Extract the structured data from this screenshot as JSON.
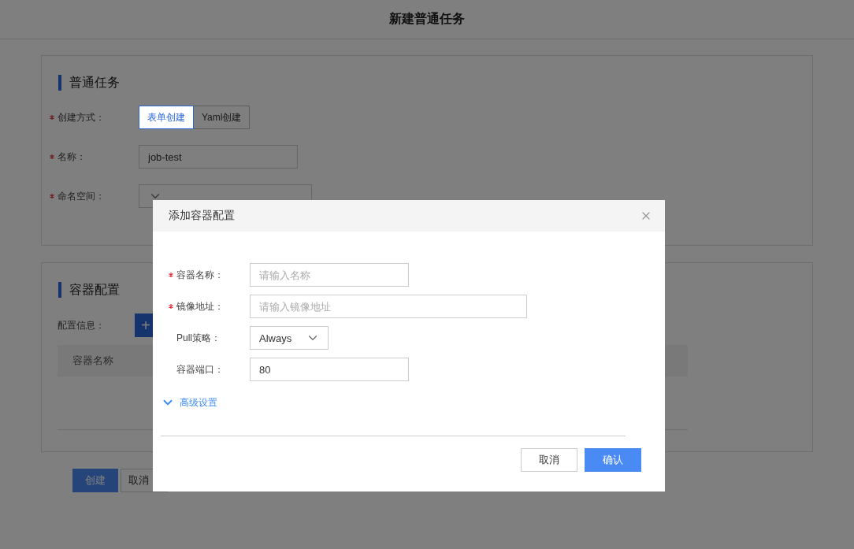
{
  "header": {
    "title": "新建普通任务"
  },
  "basic_section": {
    "title": "普通任务",
    "fields": [
      {
        "kind": "segmented",
        "label": "创建方式：",
        "required": true,
        "options": [
          {
            "label": "表单创建",
            "selected": true
          },
          {
            "label": "Yaml创建",
            "selected": false
          }
        ]
      },
      {
        "kind": "input",
        "label": "名称：",
        "required": true,
        "value": "job-test"
      },
      {
        "kind": "select",
        "label": "命名空间：",
        "required": true
      }
    ]
  },
  "container_section": {
    "title": "容器配置",
    "config_label": "配置信息：",
    "add_button": "+",
    "table": {
      "columns": [
        "容器名称"
      ]
    }
  },
  "actions": [
    {
      "label": "创建",
      "primary": true
    },
    {
      "label": "取消",
      "primary": false
    }
  ],
  "dialog": {
    "title": "添加容器配置",
    "fields": [
      {
        "kind": "input",
        "label": "容器名称：",
        "required": true,
        "placeholder": "请输入名称"
      },
      {
        "kind": "wide_input",
        "label": "镜像地址：",
        "required": true,
        "placeholder": "请输入镜像地址"
      },
      {
        "kind": "select",
        "label": "Pull策略：",
        "required": false,
        "value": "Always"
      },
      {
        "kind": "input",
        "label": "容器端口：",
        "required": false,
        "value": "80"
      }
    ],
    "advanced": {
      "label": "高级设置",
      "expanded": false
    },
    "buttons": [
      {
        "label": "取消",
        "primary": false
      },
      {
        "label": "确认",
        "primary": true
      }
    ]
  }
}
